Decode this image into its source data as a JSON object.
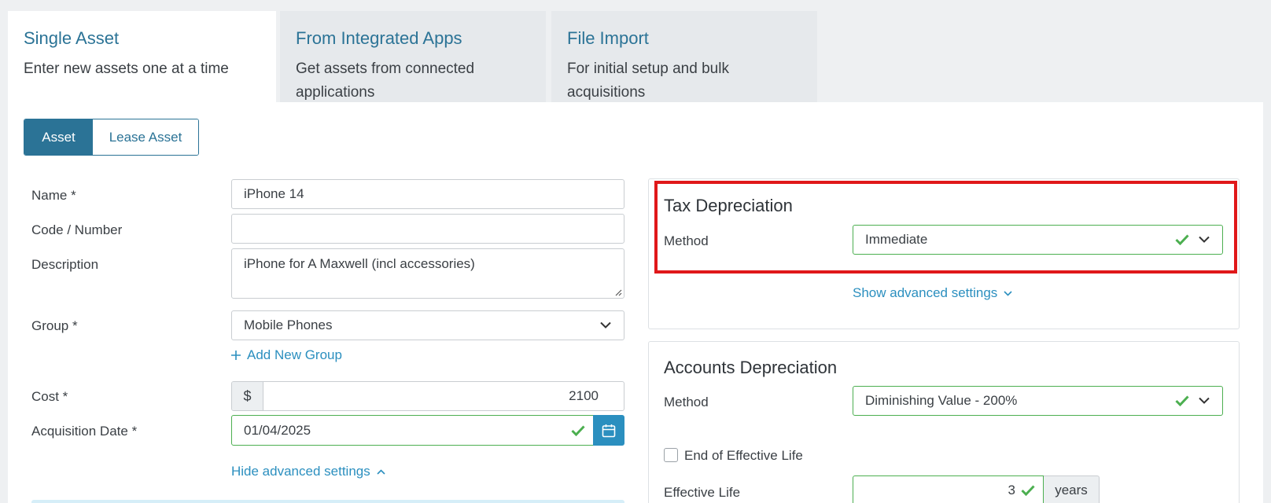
{
  "tabs": [
    {
      "title": "Single Asset",
      "desc": "Enter new assets one at a time"
    },
    {
      "title": "From Integrated Apps",
      "desc": "Get assets from connected applications"
    },
    {
      "title": "File Import",
      "desc": "For initial setup and bulk acquisitions"
    }
  ],
  "segment": {
    "asset": "Asset",
    "lease": "Lease Asset"
  },
  "form": {
    "name_label": "Name *",
    "name_value": "iPhone 14",
    "code_label": "Code / Number",
    "code_value": "",
    "desc_label": "Description",
    "desc_value": "iPhone for A Maxwell (incl accessories)",
    "group_label": "Group *",
    "group_value": "Mobile Phones",
    "add_group": "Add New Group",
    "cost_label": "Cost *",
    "cost_prefix": "$",
    "cost_value": "2100",
    "date_label": "Acquisition Date *",
    "date_value": "01/04/2025",
    "hide_advanced": "Hide advanced settings"
  },
  "tax": {
    "title": "Tax Depreciation",
    "method_label": "Method",
    "method_value": "Immediate",
    "show_advanced": "Show advanced settings"
  },
  "accounts": {
    "title": "Accounts Depreciation",
    "method_label": "Method",
    "method_value": "Diminishing Value - 200%",
    "end_label": "End of Effective Life",
    "life_label": "Effective Life",
    "life_value": "3",
    "life_unit": "years"
  },
  "colors": {
    "accent": "#2b7396",
    "link": "#2b8fbf",
    "valid": "#4caf50",
    "highlight": "#e0181a"
  }
}
